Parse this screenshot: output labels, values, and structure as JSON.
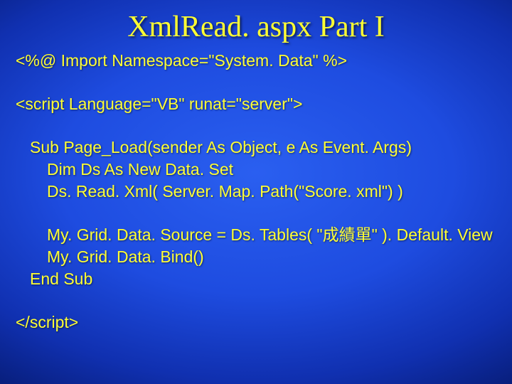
{
  "title": "XmlRead. aspx Part I",
  "lines": {
    "l1": "<%@ Import Namespace=\"System. Data\" %>",
    "l2": "<script Language=\"VB\" runat=\"server\">",
    "l3": "Sub Page_Load(sender As Object, e As Event. Args)",
    "l4": "Dim Ds As New Data. Set",
    "l5": "Ds. Read. Xml( Server. Map. Path(\"Score. xml\") )",
    "l6": "My. Grid. Data. Source = Ds. Tables( \"成績單\" ). Default. View",
    "l7": "My. Grid. Data. Bind()",
    "l8": "End Sub",
    "l9": "</script>"
  }
}
